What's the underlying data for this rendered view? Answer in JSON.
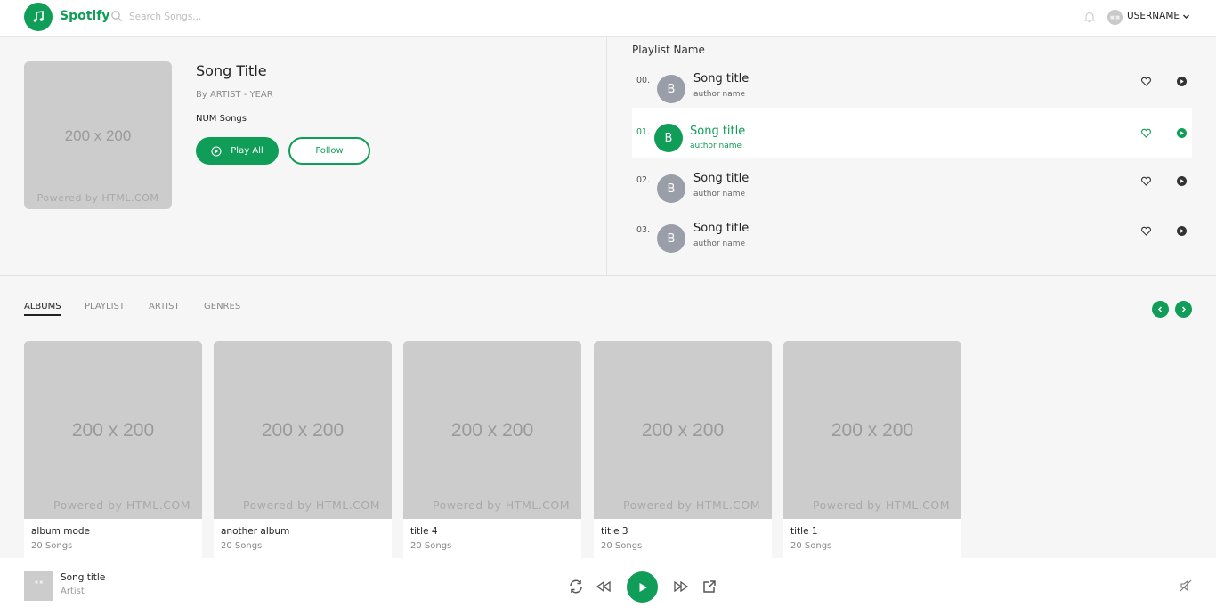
{
  "header": {
    "logo_text": "Spotify",
    "search_placeholder": "Search Songs...",
    "username": "USERNAME",
    "avatar_label": "■ ■"
  },
  "album": {
    "cover_main": "200 x 200",
    "cover_sub": "Powered by HTML.COM",
    "title": "Song Title",
    "by_line": "By ARTIST - YEAR",
    "num_songs": "NUM Songs",
    "play_all_label": "Play All",
    "follow_label": "Follow"
  },
  "playlist": {
    "name": "Playlist Name",
    "rows": [
      {
        "num": "00.",
        "avatar": "B",
        "title": "Song title",
        "author": "author name"
      },
      {
        "num": "01.",
        "avatar": "B",
        "title": "Song title",
        "author": "author name"
      },
      {
        "num": "02.",
        "avatar": "B",
        "title": "Song title",
        "author": "author name"
      },
      {
        "num": "03.",
        "avatar": "B",
        "title": "Song title",
        "author": "author name"
      }
    ],
    "active_index": 1
  },
  "tabs": {
    "albums": "ALBUMS",
    "playlist": "PLAYLIST",
    "artist": "ARTIST",
    "genres": "GENRES"
  },
  "cards": [
    {
      "title": "album mode",
      "sub": "20 Songs",
      "img_main": "200 x 200",
      "img_sub": "Powered by HTML.COM"
    },
    {
      "title": "another album",
      "sub": "20 Songs",
      "img_main": "200 x 200",
      "img_sub": "Powered by HTML.COM"
    },
    {
      "title": "title 4",
      "sub": "20 Songs",
      "img_main": "200 x 200",
      "img_sub": "Powered by HTML.COM"
    },
    {
      "title": "title 3",
      "sub": "20 Songs",
      "img_main": "200 x 200",
      "img_sub": "Powered by HTML.COM"
    },
    {
      "title": "title 1",
      "sub": "20 Songs",
      "img_main": "200 x 200",
      "img_sub": "Powered by HTML.COM"
    }
  ],
  "player": {
    "title": "Song title",
    "artist": "Artist",
    "thumb_label": "■ ■"
  },
  "colors": {
    "accent": "#0f9d58",
    "panel_bg": "#f6f6f6",
    "placeholder": "#cccccc",
    "avatar_gray": "#9a9ea8"
  }
}
